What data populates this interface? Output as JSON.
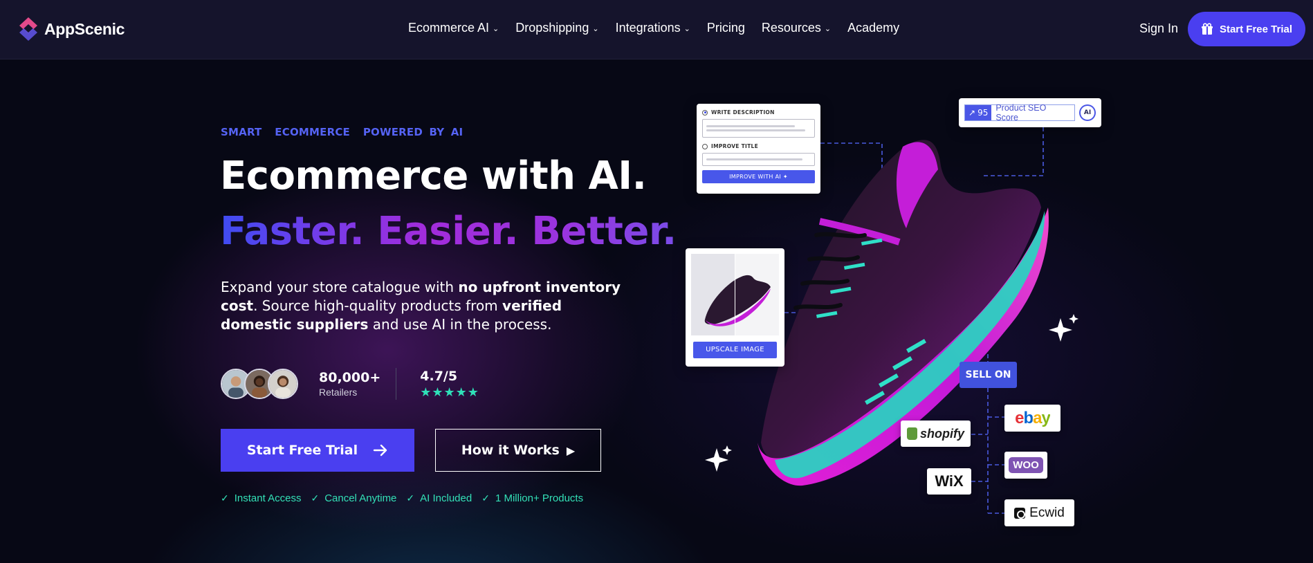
{
  "brand": {
    "name": "AppScenic"
  },
  "nav": {
    "items": [
      {
        "label": "Ecommerce AI",
        "dropdown": true
      },
      {
        "label": "Dropshipping",
        "dropdown": true
      },
      {
        "label": "Integrations",
        "dropdown": true
      },
      {
        "label": "Pricing",
        "dropdown": false
      },
      {
        "label": "Resources",
        "dropdown": true
      },
      {
        "label": "Academy",
        "dropdown": false
      }
    ],
    "sign_in": "Sign In",
    "cta": "Start Free Trial"
  },
  "hero": {
    "eyebrow": "SMART  ECOMMERCE  POWERED BY AI",
    "headline": "Ecommerce with AI.",
    "tagline": "Faster. Easier. Better.",
    "desc": {
      "p1": "Expand your store catalogue with ",
      "b1": "no upfront inventory cost",
      "p2": ". Source high-quality products from ",
      "b2": "verified domestic suppliers",
      "p3": " and use AI in the process."
    },
    "retailers": {
      "count": "80,000+",
      "label": "Retailers"
    },
    "rating": {
      "value": "4.7/5",
      "stars": "★★★★★"
    },
    "primary_cta": "Start Free Trial",
    "secondary_cta": "How it Works",
    "perks": [
      "Instant Access",
      "Cancel Anytime",
      "AI Included",
      "1 Million+ Products"
    ]
  },
  "visual": {
    "write_card": {
      "option1": "WRITE DESCRIPTION",
      "option2": "IMPROVE TITLE",
      "button": "IMPROVE WITH AI"
    },
    "seo": {
      "score": "95",
      "label": "Product SEO Score",
      "badge": "AI"
    },
    "upscale_button": "UPSCALE IMAGE",
    "sell_on": "SELL ON",
    "platforms": {
      "shopify": "shopify",
      "ebay": "ebay",
      "wix": "WiX",
      "woo": "WOO",
      "ecwid": "Ecwid"
    }
  },
  "colors": {
    "accent": "#4a3ff0",
    "eyebrow": "#5563f4",
    "perk": "#33e1b7",
    "shoe_magenta": "#c41ed8",
    "shoe_teal": "#23d8c0"
  }
}
